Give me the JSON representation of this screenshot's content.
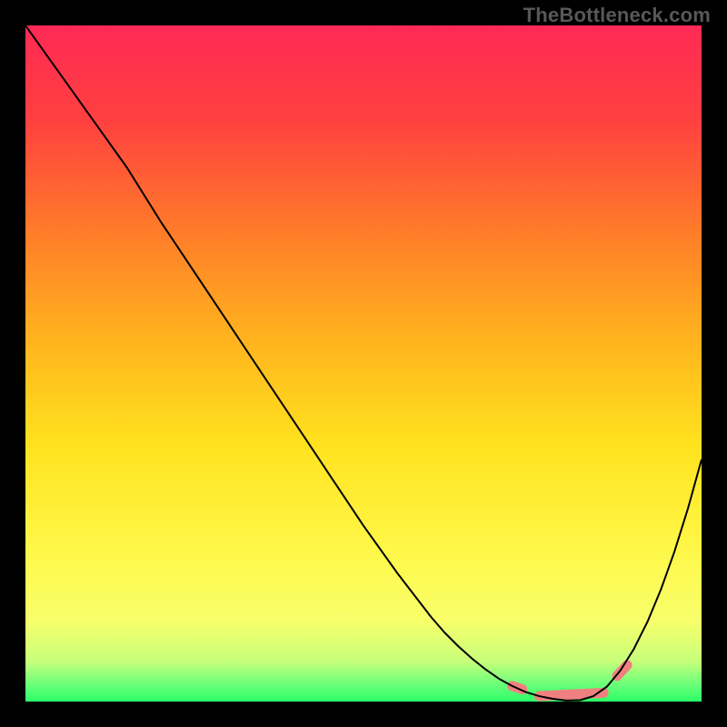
{
  "watermark": "TheBottleneck.com",
  "chart_data": {
    "type": "line",
    "title": "",
    "xlabel": "",
    "ylabel": "",
    "xlim": [
      0,
      100
    ],
    "ylim": [
      0,
      100
    ],
    "x": [
      0,
      5,
      10,
      15,
      20,
      25,
      30,
      35,
      40,
      45,
      50,
      55,
      60,
      62,
      64,
      66,
      68,
      70,
      72,
      74,
      76,
      78,
      80,
      82,
      84,
      86,
      88,
      90,
      92,
      94,
      96,
      98,
      100
    ],
    "values": [
      100,
      93,
      86,
      79,
      71,
      63.5,
      56,
      48.5,
      41,
      33.5,
      26,
      19,
      12.5,
      10.2,
      8.2,
      6.4,
      4.8,
      3.4,
      2.3,
      1.4,
      0.8,
      0.4,
      0.15,
      0.2,
      0.8,
      2.2,
      4.6,
      7.8,
      11.8,
      16.6,
      22.2,
      28.6,
      35.8
    ],
    "marker": {
      "segments": [
        {
          "x0": 72,
          "y0": 2.3,
          "x1": 73.5,
          "y1": 1.8
        },
        {
          "x0": 76,
          "y0": 0.8,
          "x1": 85.5,
          "y1": 1.3
        },
        {
          "x0": 87.5,
          "y0": 3.8,
          "x1": 89,
          "y1": 5.4
        }
      ],
      "color": "#f08080",
      "width": 11
    },
    "background": {
      "stops": [
        {
          "offset": 0.0,
          "color": "#ff2a55"
        },
        {
          "offset": 0.14,
          "color": "#ff4040"
        },
        {
          "offset": 0.3,
          "color": "#ff7a2a"
        },
        {
          "offset": 0.46,
          "color": "#ffb21e"
        },
        {
          "offset": 0.62,
          "color": "#ffe21e"
        },
        {
          "offset": 0.78,
          "color": "#fff84a"
        },
        {
          "offset": 0.88,
          "color": "#f8ff6a"
        },
        {
          "offset": 0.94,
          "color": "#c8ff7a"
        },
        {
          "offset": 0.975,
          "color": "#6aff7a"
        },
        {
          "offset": 1.0,
          "color": "#2aff66"
        }
      ]
    },
    "curve_color": "#000000",
    "curve_width": 2
  }
}
